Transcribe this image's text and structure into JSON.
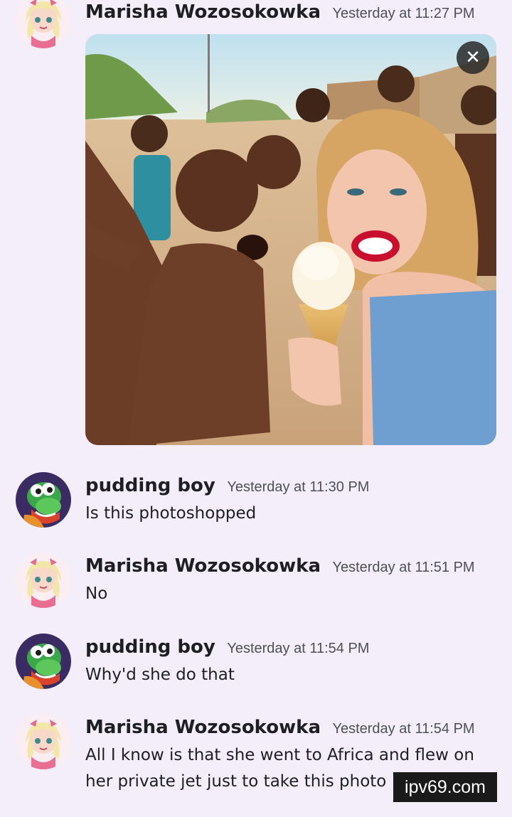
{
  "messages": [
    {
      "username": "Marisha Wozosokowka",
      "timestamp": "Yesterday at 11:27 PM",
      "avatar": "anime-girl-avatar",
      "attachment": {
        "close_label": "✕"
      }
    },
    {
      "username": "pudding boy",
      "timestamp": "Yesterday at 11:30 PM",
      "avatar": "yoshi-avatar",
      "text": "Is this photoshopped"
    },
    {
      "username": "Marisha Wozosokowka",
      "timestamp": "Yesterday at 11:51 PM",
      "avatar": "anime-girl-avatar",
      "text": "No"
    },
    {
      "username": "pudding boy",
      "timestamp": "Yesterday at 11:54 PM",
      "avatar": "yoshi-avatar",
      "text": "Why'd she do that"
    },
    {
      "username": "Marisha Wozosokowka",
      "timestamp": "Yesterday at 11:54 PM",
      "avatar": "anime-girl-avatar",
      "text": "All I know is that she went to Africa and flew on her private jet just to take this photo"
    }
  ],
  "watermark": "ipv69.com",
  "colors": {
    "background": "#f3eef9",
    "username": "#1e1f22",
    "timestamp": "#4e5058"
  }
}
